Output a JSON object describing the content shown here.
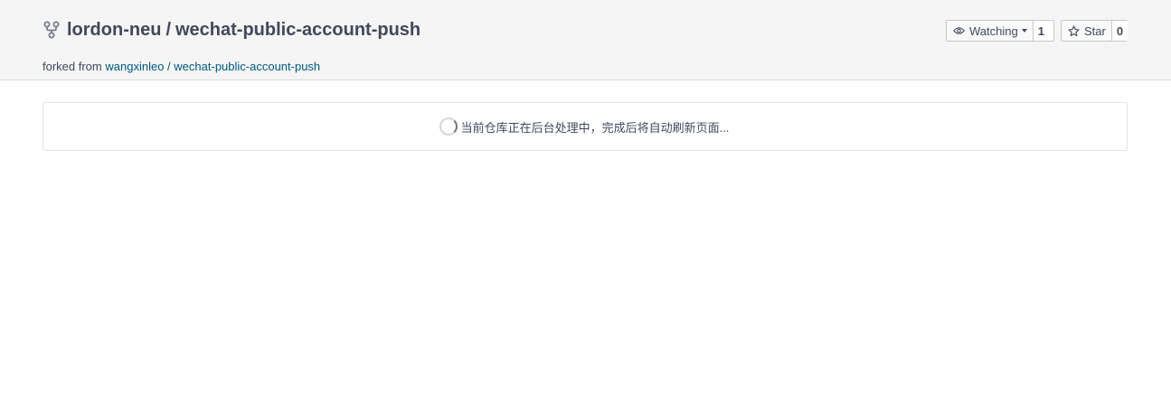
{
  "repo": {
    "owner": "lordon-neu",
    "separator": "/",
    "name": "wechat-public-account-push",
    "fork_icon": "fork-icon"
  },
  "forked_from": {
    "prefix": "forked from",
    "owner": "wangxinleo",
    "separator": "/",
    "name": "wechat-public-account-push"
  },
  "watch": {
    "label": "Watching",
    "count": "1",
    "icon": "eye-icon"
  },
  "star": {
    "label": "Star",
    "count": "0",
    "icon": "star-icon"
  },
  "notice": {
    "text": "当前仓库正在后台处理中，完成后将自动刷新页面..."
  }
}
